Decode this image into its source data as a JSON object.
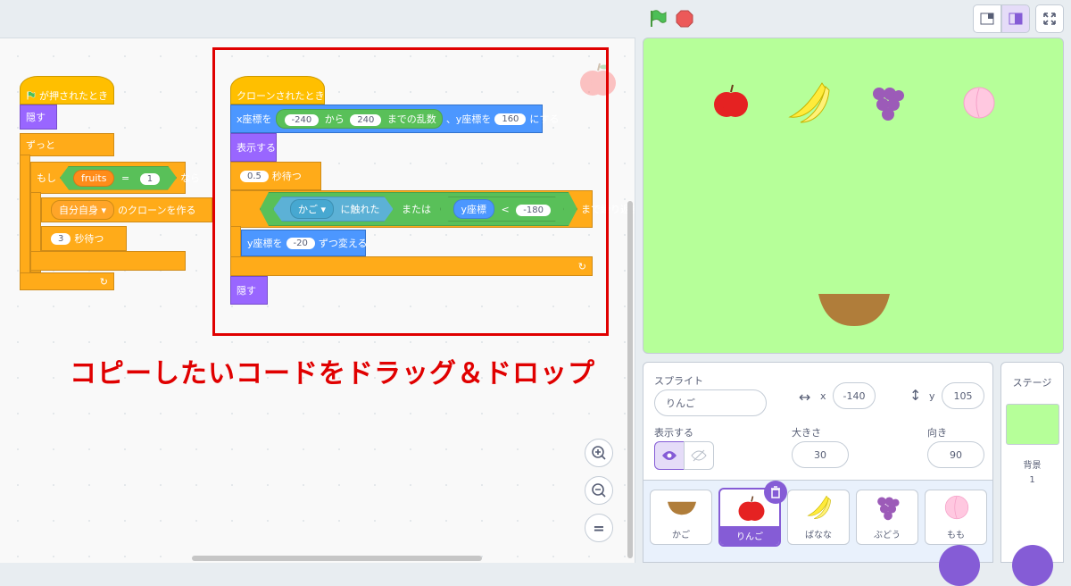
{
  "header": {
    "flag_label": "",
    "stop_label": ""
  },
  "code": {
    "script1": {
      "hat": "が押されたとき",
      "hide": "隠す",
      "forever": "ずっと",
      "if_label": "もし",
      "var_name": "fruits",
      "eq": "=",
      "eq_value": "1",
      "then": "なら",
      "clone_target": "自分自身",
      "clone_suffix": "のクローンを作る",
      "wait_value": "3",
      "wait_label": "秒待つ"
    },
    "script2": {
      "hat": "クローンされたとき",
      "goto_x_label": "x座標を",
      "rand_from": "-240",
      "rand_mid": "から",
      "rand_to": "240",
      "rand_suffix": "までの乱数",
      "goto_y_label": "、y座標を",
      "y_value": "160",
      "goto_suffix": "にする",
      "show": "表示する",
      "wait_value": "0.5",
      "wait_label": "秒待つ",
      "touch_target": "かご",
      "touch_label": "に触れた",
      "or_label": "または",
      "ypos_label": "y座標",
      "lt": "<",
      "lt_value": "-180",
      "until_label": "まで繰り返す",
      "change_label": "y座標を",
      "change_value": "-20",
      "change_suffix": "ずつ変える",
      "hide": "隠す"
    },
    "zoom_in": "+",
    "zoom_out": "−",
    "zoom_reset": "="
  },
  "annotation": {
    "text": "コピーしたいコードをドラッグ＆ドロップ",
    "color": "#e00000"
  },
  "sprite_info": {
    "sprite_label": "スプライト",
    "sprite_name": "りんご",
    "x_label": "x",
    "x_value": "-140",
    "y_label": "y",
    "y_value": "105",
    "show_label": "表示する",
    "size_label": "大きさ",
    "size_value": "30",
    "direction_label": "向き",
    "direction_value": "90"
  },
  "sprites": [
    {
      "name": "かご",
      "selected": false
    },
    {
      "name": "りんご",
      "selected": true
    },
    {
      "name": "ばなな",
      "selected": false
    },
    {
      "name": "ぶどう",
      "selected": false
    },
    {
      "name": "もも",
      "selected": false
    }
  ],
  "stage_panel": {
    "title": "ステージ",
    "backdrop_label": "背景",
    "backdrop_count": "1"
  },
  "colors": {
    "accent": "#855cd6",
    "stage_bg": "#b6ff99"
  },
  "icons": [
    "green-flag-icon",
    "stop-icon",
    "small-stage-icon",
    "large-stage-icon",
    "fullscreen-icon",
    "zoom-in-icon",
    "zoom-out-icon",
    "eye-icon",
    "eye-off-icon",
    "trash-icon"
  ]
}
